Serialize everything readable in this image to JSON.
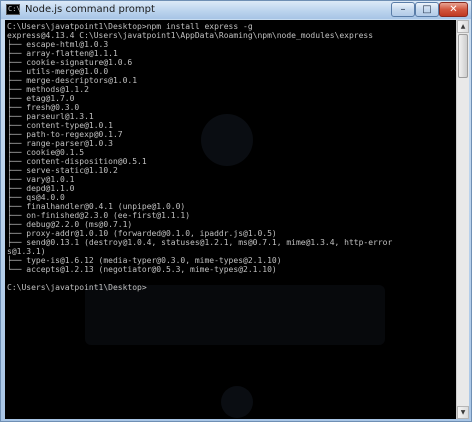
{
  "window": {
    "title": "Node.js command prompt",
    "icon_label": "C:\\",
    "minimize_label": "–",
    "maximize_label": "□",
    "close_label": "✕"
  },
  "scrollbar": {
    "up_label": "▲",
    "down_label": "▼",
    "position_fraction": 0.0
  },
  "colors": {
    "console_background": "#000000",
    "console_text": "#c0c0c0",
    "titlebar": "#bcd4ee",
    "close_button": "#c9452c"
  },
  "terminal": {
    "lines": [
      "C:\\Users\\javatpoint1\\Desktop>npm install express -g",
      "express@4.13.4 C:\\Users\\javatpoint1\\AppData\\Roaming\\npm\\node_modules\\express",
      "├── escape-html@1.0.3",
      "├── array-flatten@1.1.1",
      "├── cookie-signature@1.0.6",
      "├── utils-merge@1.0.0",
      "├── merge-descriptors@1.0.1",
      "├── methods@1.1.2",
      "├── etag@1.7.0",
      "├── fresh@0.3.0",
      "├── parseurl@1.3.1",
      "├── content-type@1.0.1",
      "├── path-to-regexp@0.1.7",
      "├── range-parser@1.0.3",
      "├── cookie@0.1.5",
      "├── content-disposition@0.5.1",
      "├── serve-static@1.10.2",
      "├── vary@1.0.1",
      "├── depd@1.1.0",
      "├── qs@4.0.0",
      "├── finalhandler@0.4.1 (unpipe@1.0.0)",
      "├── on-finished@2.3.0 (ee-first@1.1.1)",
      "├── debug@2.2.0 (ms@0.7.1)",
      "├── proxy-addr@1.0.10 (forwarded@0.1.0, ipaddr.js@1.0.5)",
      "├── send@0.13.1 (destroy@1.0.4, statuses@1.2.1, ms@0.7.1, mime@1.3.4, http-error",
      "s@1.3.1)",
      "├── type-is@1.6.12 (media-typer@0.3.0, mime-types@2.1.10)",
      "└── accepts@1.2.13 (negotiator@0.5.3, mime-types@2.1.10)",
      "",
      "C:\\Users\\javatpoint1\\Desktop>"
    ]
  }
}
